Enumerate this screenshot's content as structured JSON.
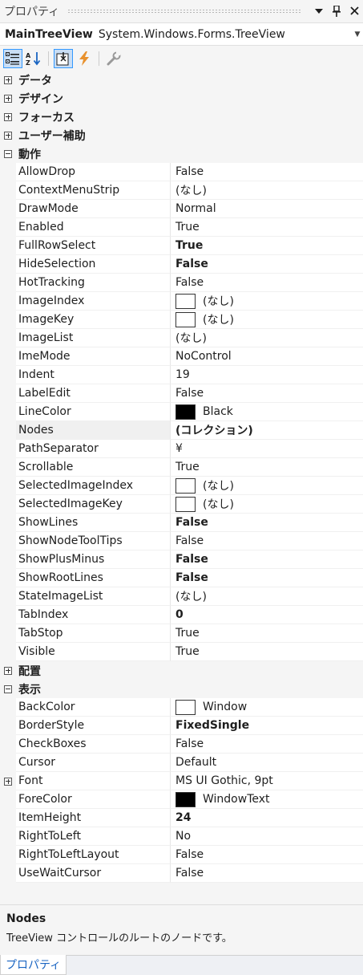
{
  "window": {
    "title": "プロパティ"
  },
  "object_selector": {
    "name": "MainTreeView",
    "type": "System.Windows.Forms.TreeView"
  },
  "grid": {
    "categories_before": [
      {
        "name": "データ",
        "expanded": false
      },
      {
        "name": "デザイン",
        "expanded": false
      },
      {
        "name": "フォーカス",
        "expanded": false
      },
      {
        "name": "ユーザー補助",
        "expanded": false
      }
    ],
    "behavior": {
      "name": "動作",
      "properties": [
        {
          "name": "AllowDrop",
          "value": "False"
        },
        {
          "name": "ContextMenuStrip",
          "value": "(なし)"
        },
        {
          "name": "DrawMode",
          "value": "Normal"
        },
        {
          "name": "Enabled",
          "value": "True"
        },
        {
          "name": "FullRowSelect",
          "value": "True"
        },
        {
          "name": "HideSelection",
          "value": "False"
        },
        {
          "name": "HotTracking",
          "value": "False"
        },
        {
          "name": "ImageIndex",
          "value": "(なし)"
        },
        {
          "name": "ImageKey",
          "value": "(なし)"
        },
        {
          "name": "ImageList",
          "value": "(なし)"
        },
        {
          "name": "ImeMode",
          "value": "NoControl"
        },
        {
          "name": "Indent",
          "value": "19"
        },
        {
          "name": "LabelEdit",
          "value": "False"
        },
        {
          "name": "LineColor",
          "value": "Black"
        },
        {
          "name": "Nodes",
          "value": "(コレクション)"
        },
        {
          "name": "PathSeparator",
          "value": "¥"
        },
        {
          "name": "Scrollable",
          "value": "True"
        },
        {
          "name": "SelectedImageIndex",
          "value": "(なし)"
        },
        {
          "name": "SelectedImageKey",
          "value": "(なし)"
        },
        {
          "name": "ShowLines",
          "value": "False"
        },
        {
          "name": "ShowNodeToolTips",
          "value": "False"
        },
        {
          "name": "ShowPlusMinus",
          "value": "False"
        },
        {
          "name": "ShowRootLines",
          "value": "False"
        },
        {
          "name": "StateImageList",
          "value": "(なし)"
        },
        {
          "name": "TabIndex",
          "value": "0"
        },
        {
          "name": "TabStop",
          "value": "True"
        },
        {
          "name": "Visible",
          "value": "True"
        }
      ]
    },
    "layout": {
      "name": "配置"
    },
    "appearance": {
      "name": "表示",
      "properties": [
        {
          "name": "BackColor",
          "value": "Window"
        },
        {
          "name": "BorderStyle",
          "value": "FixedSingle"
        },
        {
          "name": "CheckBoxes",
          "value": "False"
        },
        {
          "name": "Cursor",
          "value": "Default"
        },
        {
          "name": "Font",
          "value": "MS UI Gothic, 9pt"
        },
        {
          "name": "ForeColor",
          "value": "WindowText"
        },
        {
          "name": "ItemHeight",
          "value": "24"
        },
        {
          "name": "RightToLeft",
          "value": "No"
        },
        {
          "name": "RightToLeftLayout",
          "value": "False"
        },
        {
          "name": "UseWaitCursor",
          "value": "False"
        }
      ]
    }
  },
  "description": {
    "title": "Nodes",
    "text": "TreeView コントロールのルートのノードです。"
  },
  "bottom_tab": {
    "label": "プロパティ"
  },
  "colors": {
    "accent": "#3399ff",
    "tab_text": "#1a65c2",
    "black_swatch": "#000000",
    "white_swatch": "#ffffff"
  },
  "icons": [
    "pin-icon",
    "close-icon",
    "categorized-icon",
    "alphabetical-icon",
    "properties-icon",
    "events-icon",
    "property-pages-icon"
  ]
}
